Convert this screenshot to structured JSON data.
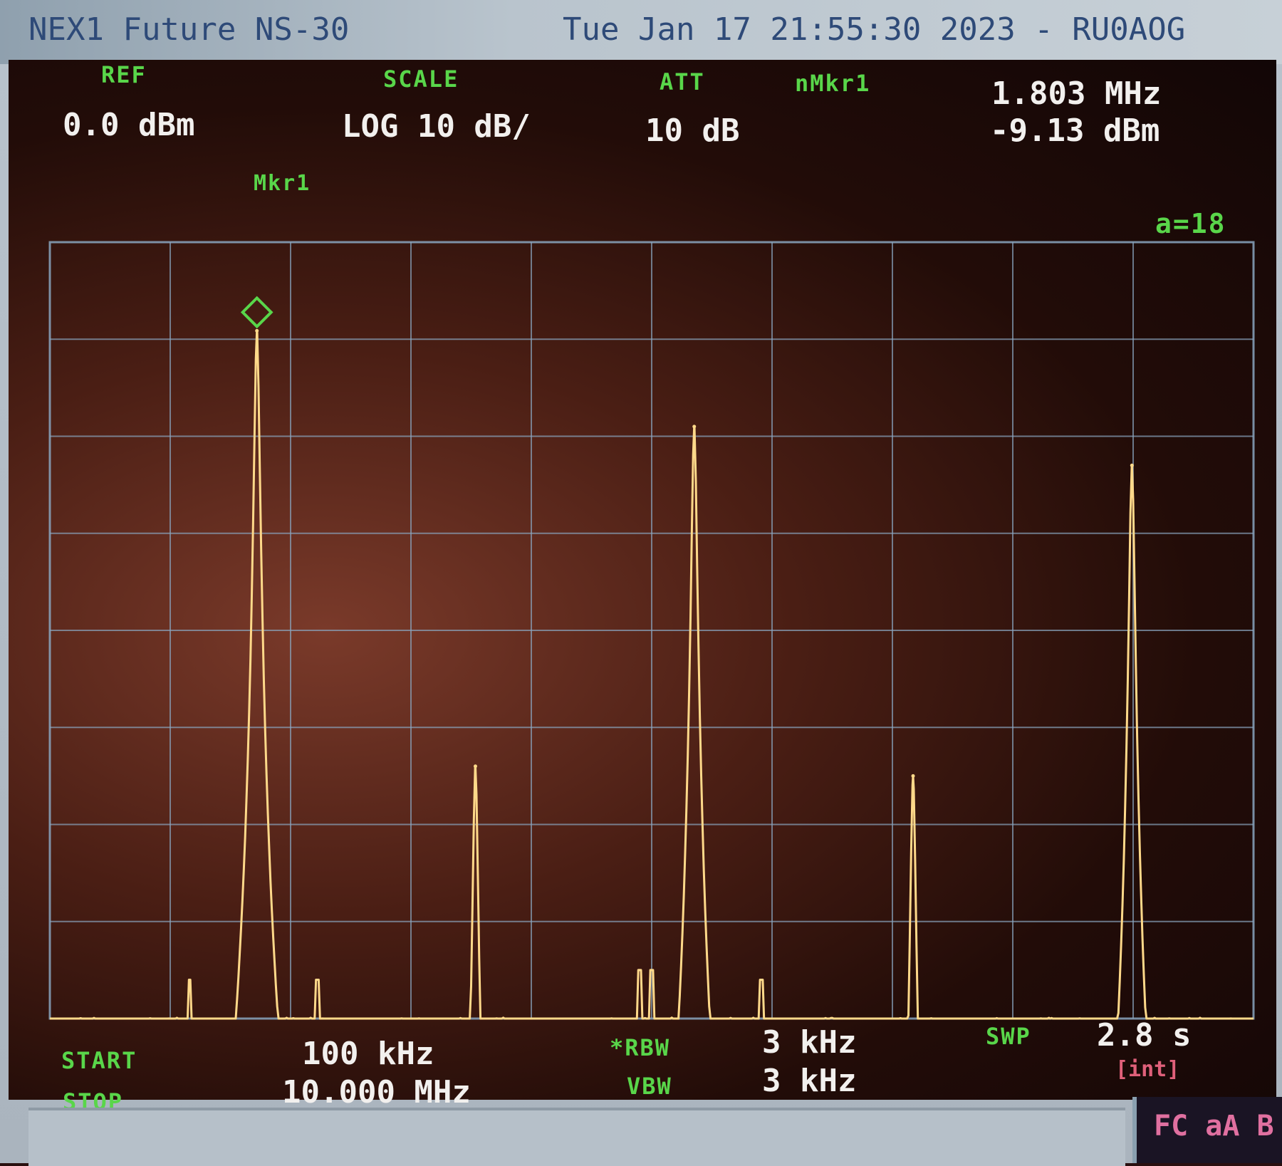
{
  "window": {
    "title_left": "NEX1 Future NS-30",
    "title_right": "Tue Jan 17 21:55:30 2023 -  RU0AOG"
  },
  "header": {
    "ref_label": "REF",
    "ref_value": "0.0 dBm",
    "scale_label": "SCALE",
    "scale_value": "LOG 10 dB/",
    "att_label": "ATT",
    "att_value": "10 dB",
    "marker_label": "nMkr1",
    "marker_freq": "1.803 MHz",
    "marker_level": "-9.13 dBm"
  },
  "plot": {
    "marker_name": "Mkr1",
    "average_label": "a=18"
  },
  "footer": {
    "start_label": "START",
    "start_value": "100 kHz",
    "stop_label": "STOP",
    "stop_value": "10.000 MHz",
    "rbw_label": "*RBW",
    "rbw_value": "3 kHz",
    "vbw_label": "VBW",
    "vbw_value": "3 kHz",
    "swp_label": "SWP",
    "swp_value": "2.8 s",
    "swp_mode": "[int]",
    "status_text": "FC aA B"
  },
  "colors": {
    "trace": "#ffd98a",
    "grid": "#8aa6c0",
    "label_green": "#59d64a",
    "value_white": "#f2f0ee"
  },
  "chart_data": {
    "type": "line",
    "xlim": [
      0.1,
      10.0
    ],
    "ylim": [
      -80,
      0
    ],
    "y_divisions": 8,
    "x_divisions": 10,
    "x_unit": "MHz",
    "y_unit": "dBm",
    "grid": true,
    "noise_floor": -80,
    "peaks": [
      {
        "x": 1.803,
        "y": -9.13
      },
      {
        "x": 3.6,
        "y": -54
      },
      {
        "x": 5.4,
        "y": -19
      },
      {
        "x": 7.2,
        "y": -55
      },
      {
        "x": 9.0,
        "y": -23
      }
    ],
    "spurs": [
      {
        "x": 1.25,
        "y": -76
      },
      {
        "x": 2.3,
        "y": -76
      },
      {
        "x": 4.95,
        "y": -75
      },
      {
        "x": 5.05,
        "y": -75
      },
      {
        "x": 5.95,
        "y": -76
      }
    ]
  }
}
